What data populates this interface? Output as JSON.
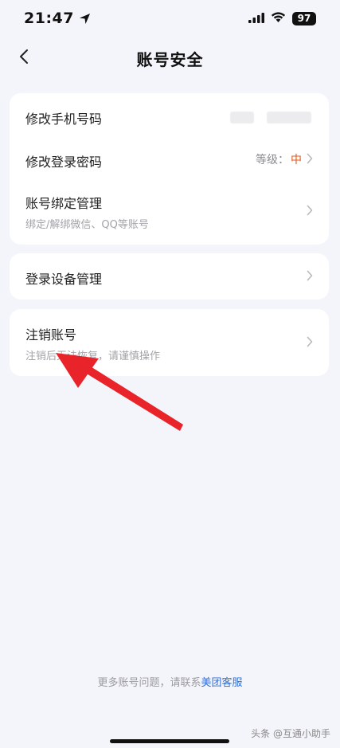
{
  "status_bar": {
    "time": "21:47",
    "battery": "97"
  },
  "nav": {
    "title": "账号安全"
  },
  "account_card": {
    "phone_label": "修改手机号码",
    "password_label": "修改登录密码",
    "password_level_prefix": "等级：",
    "password_level_value": "中",
    "binding_label": "账号绑定管理",
    "binding_sub": "绑定/解绑微信、QQ等账号"
  },
  "device_card": {
    "label": "登录设备管理"
  },
  "cancel_card": {
    "label": "注销账号",
    "sub": "注销后无法恢复，请谨慎操作"
  },
  "footer": {
    "help_text": "更多账号问题，请联系",
    "link_text": "美团客服"
  },
  "watermark": "头条 @互通小助手",
  "colors": {
    "background": "#f4f5fa",
    "card": "#ffffff",
    "level_accent": "#e05a1e",
    "link": "#2f6fd6",
    "annotation_arrow": "#e8232a"
  }
}
